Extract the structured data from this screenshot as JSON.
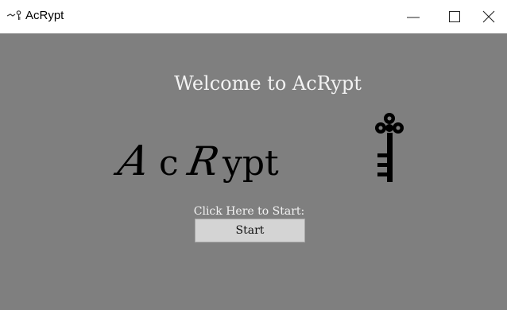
{
  "window": {
    "title": "AcRypt",
    "app_icon": "key-icon",
    "controls": [
      "minimize-icon",
      "maximize-icon",
      "close-icon"
    ]
  },
  "main": {
    "welcome_text": "Welcome to AcRypt",
    "logo_text": "AcRypt",
    "logo_icon": "key-icon",
    "start_caption": "Click Here to Start:",
    "start_button_label": "Start"
  },
  "colors": {
    "client_background": "#7f7f7f",
    "titlebar_background": "#ffffff",
    "welcome_text": "#f2f2f2",
    "logo_text": "#000000",
    "button_background": "#d4d4d4"
  }
}
